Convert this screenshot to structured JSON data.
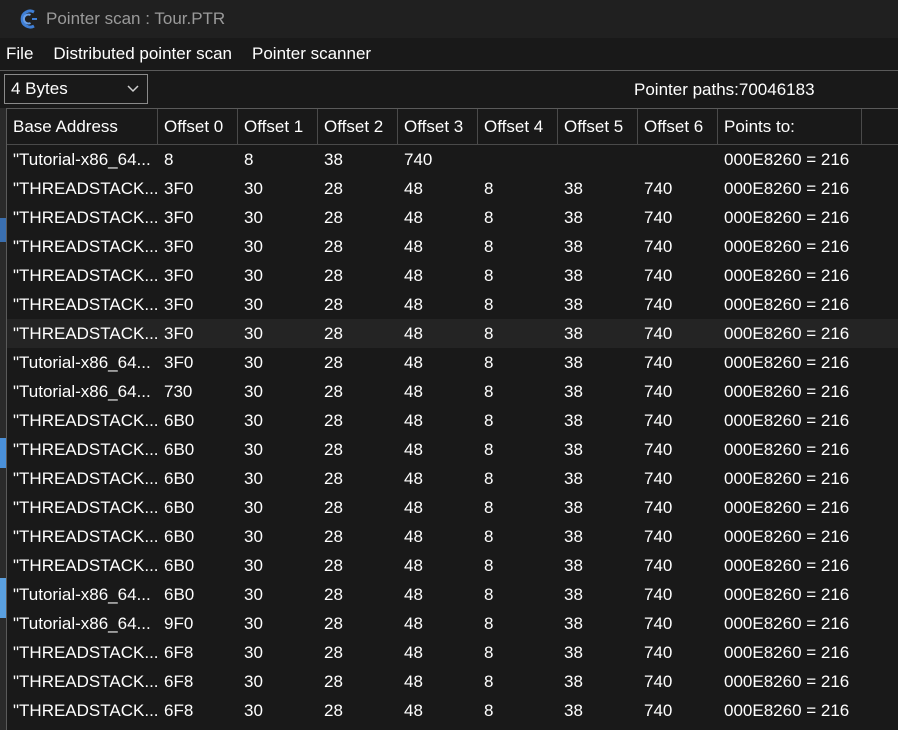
{
  "window": {
    "title": "Pointer scan : Tour.PTR"
  },
  "menu": [
    "File",
    "Distributed pointer scan",
    "Pointer scanner"
  ],
  "toolbar": {
    "value_type": "4 Bytes",
    "pointer_paths": "Pointer paths:70046183"
  },
  "table": {
    "columns": [
      "Base Address",
      "Offset 0",
      "Offset 1",
      "Offset 2",
      "Offset 3",
      "Offset 4",
      "Offset 5",
      "Offset 6",
      "Points to:"
    ],
    "rows": [
      [
        "\"Tutorial-x86_64...",
        "8",
        "8",
        "38",
        "740",
        "",
        "",
        "",
        "000E8260 = 216"
      ],
      [
        "\"THREADSTACK...",
        "3F0",
        "30",
        "28",
        "48",
        "8",
        "38",
        "740",
        "000E8260 = 216"
      ],
      [
        "\"THREADSTACK...",
        "3F0",
        "30",
        "28",
        "48",
        "8",
        "38",
        "740",
        "000E8260 = 216"
      ],
      [
        "\"THREADSTACK...",
        "3F0",
        "30",
        "28",
        "48",
        "8",
        "38",
        "740",
        "000E8260 = 216"
      ],
      [
        "\"THREADSTACK...",
        "3F0",
        "30",
        "28",
        "48",
        "8",
        "38",
        "740",
        "000E8260 = 216"
      ],
      [
        "\"THREADSTACK...",
        "3F0",
        "30",
        "28",
        "48",
        "8",
        "38",
        "740",
        "000E8260 = 216"
      ],
      [
        "\"THREADSTACK...",
        "3F0",
        "30",
        "28",
        "48",
        "8",
        "38",
        "740",
        "000E8260 = 216"
      ],
      [
        "\"Tutorial-x86_64...",
        "3F0",
        "30",
        "28",
        "48",
        "8",
        "38",
        "740",
        "000E8260 = 216"
      ],
      [
        "\"Tutorial-x86_64...",
        "730",
        "30",
        "28",
        "48",
        "8",
        "38",
        "740",
        "000E8260 = 216"
      ],
      [
        "\"THREADSTACK...",
        "6B0",
        "30",
        "28",
        "48",
        "8",
        "38",
        "740",
        "000E8260 = 216"
      ],
      [
        "\"THREADSTACK...",
        "6B0",
        "30",
        "28",
        "48",
        "8",
        "38",
        "740",
        "000E8260 = 216"
      ],
      [
        "\"THREADSTACK...",
        "6B0",
        "30",
        "28",
        "48",
        "8",
        "38",
        "740",
        "000E8260 = 216"
      ],
      [
        "\"THREADSTACK...",
        "6B0",
        "30",
        "28",
        "48",
        "8",
        "38",
        "740",
        "000E8260 = 216"
      ],
      [
        "\"THREADSTACK...",
        "6B0",
        "30",
        "28",
        "48",
        "8",
        "38",
        "740",
        "000E8260 = 216"
      ],
      [
        "\"THREADSTACK...",
        "6B0",
        "30",
        "28",
        "48",
        "8",
        "38",
        "740",
        "000E8260 = 216"
      ],
      [
        "\"Tutorial-x86_64...",
        "6B0",
        "30",
        "28",
        "48",
        "8",
        "38",
        "740",
        "000E8260 = 216"
      ],
      [
        "\"Tutorial-x86_64...",
        "9F0",
        "30",
        "28",
        "48",
        "8",
        "38",
        "740",
        "000E8260 = 216"
      ],
      [
        "\"THREADSTACK...",
        "6F8",
        "30",
        "28",
        "48",
        "8",
        "38",
        "740",
        "000E8260 = 216"
      ],
      [
        "\"THREADSTACK...",
        "6F8",
        "30",
        "28",
        "48",
        "8",
        "38",
        "740",
        "000E8260 = 216"
      ],
      [
        "\"THREADSTACK...",
        "6F8",
        "30",
        "28",
        "48",
        "8",
        "38",
        "740",
        "000E8260 = 216"
      ]
    ],
    "selected_row": 6
  },
  "colors": {
    "background": "#191919",
    "titlebar": "#202020",
    "title_text": "#9a9a9a",
    "text": "#ffffff",
    "row_highlight": "#242424",
    "app_icon": "#3f7fd6"
  },
  "icons": {
    "app": "cheat-engine-icon",
    "dropdown": "chevron-down-icon"
  }
}
